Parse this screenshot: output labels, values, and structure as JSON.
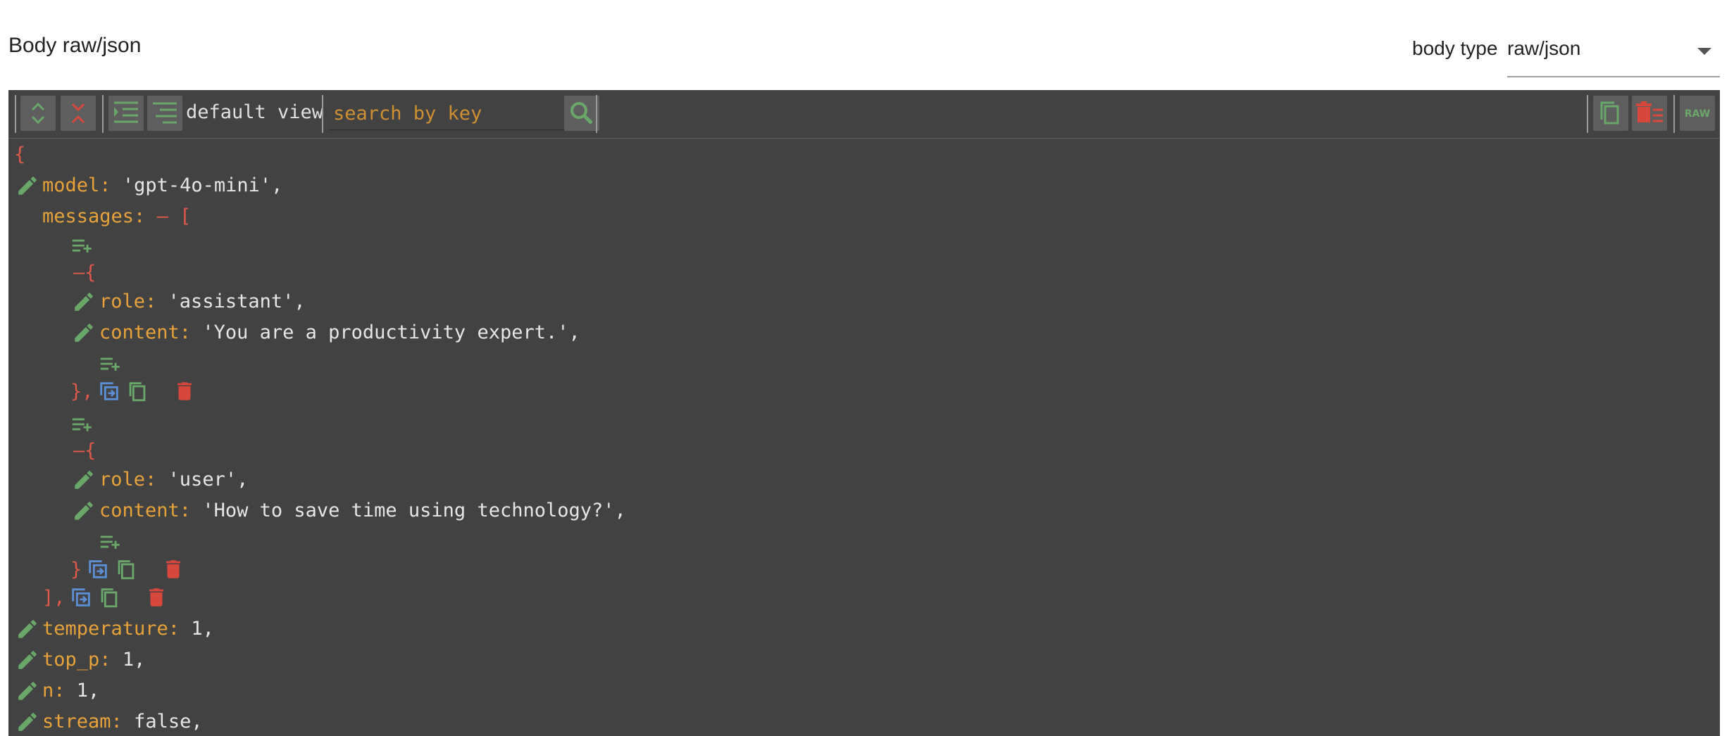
{
  "header": {
    "title": "Body raw/json",
    "body_type_label": "body type",
    "body_type_value": "raw/json"
  },
  "toolbar": {
    "view_label": "default view",
    "search_placeholder": "search by key",
    "raw_label": "RAW"
  },
  "json": {
    "open_brace": "{",
    "model_key": "model:",
    "model_value": "'gpt-4o-mini',",
    "messages_key": "messages:",
    "messages_open": "— [",
    "msg1_open": "—{",
    "msg1_role_key": "role:",
    "msg1_role_value": "'assistant',",
    "msg1_content_key": "content:",
    "msg1_content_value": "'You are a productivity expert.',",
    "msg1_close": "},",
    "msg2_open": "—{",
    "msg2_role_key": "role:",
    "msg2_role_value": "'user',",
    "msg2_content_key": "content:",
    "msg2_content_value": "'How to save time using technology?',",
    "msg2_close": "}",
    "messages_close": "],",
    "temperature_key": "temperature:",
    "temperature_value": "1,",
    "top_p_key": "top_p:",
    "top_p_value": "1,",
    "n_key": "n:",
    "n_value": "1,",
    "stream_key": "stream:",
    "stream_value": "false,"
  },
  "colors": {
    "editor_bg": "#424242",
    "key": "#e8a23a",
    "value": "#e6e6e6",
    "bracket": "#e05a4a",
    "edit_icon": "#6aa86a",
    "clone_icon": "#5b8fd6",
    "delete_icon": "#d8473b"
  }
}
